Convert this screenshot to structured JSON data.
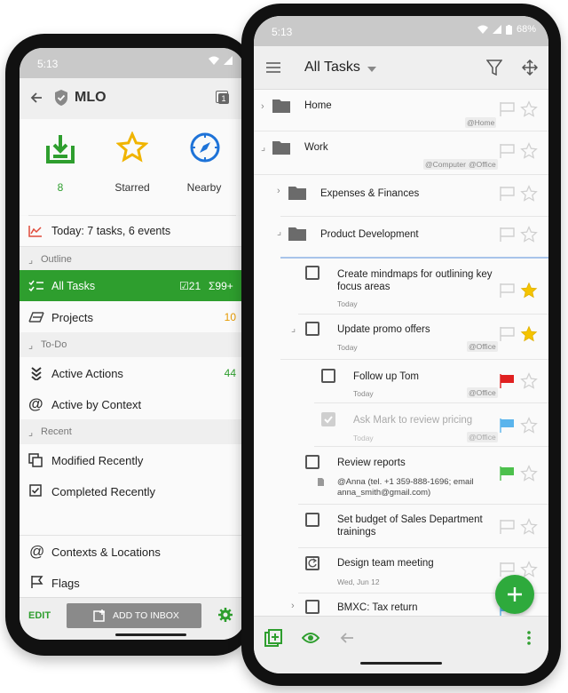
{
  "left_phone": {
    "status": {
      "time": "5:13"
    },
    "header": {
      "title": "MLO",
      "back_icon": "arrow-left-icon",
      "window_icon": "window-count-icon",
      "window_count": "1"
    },
    "quick": [
      {
        "icon": "inbox-download-icon",
        "label": "8"
      },
      {
        "icon": "star-icon",
        "label": "Starred"
      },
      {
        "icon": "compass-icon",
        "label": "Nearby"
      }
    ],
    "today": "Today: 7 tasks, 6 events",
    "outline_label": "Outline",
    "all_tasks": {
      "label": "All Tasks",
      "count_a": "21",
      "count_b": "99+"
    },
    "projects": {
      "label": "Projects",
      "count": "10"
    },
    "todo_label": "To-Do",
    "active_actions": {
      "label": "Active Actions",
      "count": "44"
    },
    "active_context": {
      "label": "Active by Context"
    },
    "recent_label": "Recent",
    "modified": {
      "label": "Modified Recently"
    },
    "completed": {
      "label": "Completed Recently"
    },
    "contexts": {
      "label": "Contexts & Locations"
    },
    "flags": {
      "label": "Flags"
    },
    "bottom": {
      "edit": "EDIT",
      "add": "ADD TO INBOX"
    },
    "colors": {
      "green": "#2e9e2e",
      "orange": "#e69a00",
      "blue": "#1e73d8"
    }
  },
  "right_phone": {
    "status": {
      "time": "5:13",
      "battery": "68%"
    },
    "header": {
      "title": "All Tasks"
    },
    "rows": {
      "home": {
        "title": "Home",
        "tag": "@Home"
      },
      "work": {
        "title": "Work",
        "tag1": "@Computer",
        "tag2": "@Office"
      },
      "expenses": {
        "title": "Expenses & Finances"
      },
      "prod": {
        "title": "Product Development"
      },
      "mindmaps": {
        "title": "Create mindmaps for outlining key focus areas",
        "sub": "Today"
      },
      "promo": {
        "title": "Update promo offers",
        "sub": "Today",
        "tag": "@Office"
      },
      "follow": {
        "title": "Follow up Tom",
        "sub": "Today",
        "tag": "@Office"
      },
      "ask": {
        "title": "Ask Mark to review pricing",
        "sub": "Today",
        "tag": "@Office"
      },
      "reports": {
        "title": "Review reports",
        "note": "@Anna (tel. +1 359-888-1696; email anna_smith@gmail.com)"
      },
      "budget": {
        "title": "Set budget of Sales Department trainings"
      },
      "design": {
        "title": "Design team meeting",
        "sub": "Wed, Jun 12"
      },
      "bmxc": {
        "title": "BMXC: Tax return"
      }
    },
    "colors": {
      "star": "#f5c400",
      "red": "#e02020",
      "blue": "#5ab4ec",
      "green": "#4cc04c",
      "fab": "#2eaa3c"
    }
  }
}
